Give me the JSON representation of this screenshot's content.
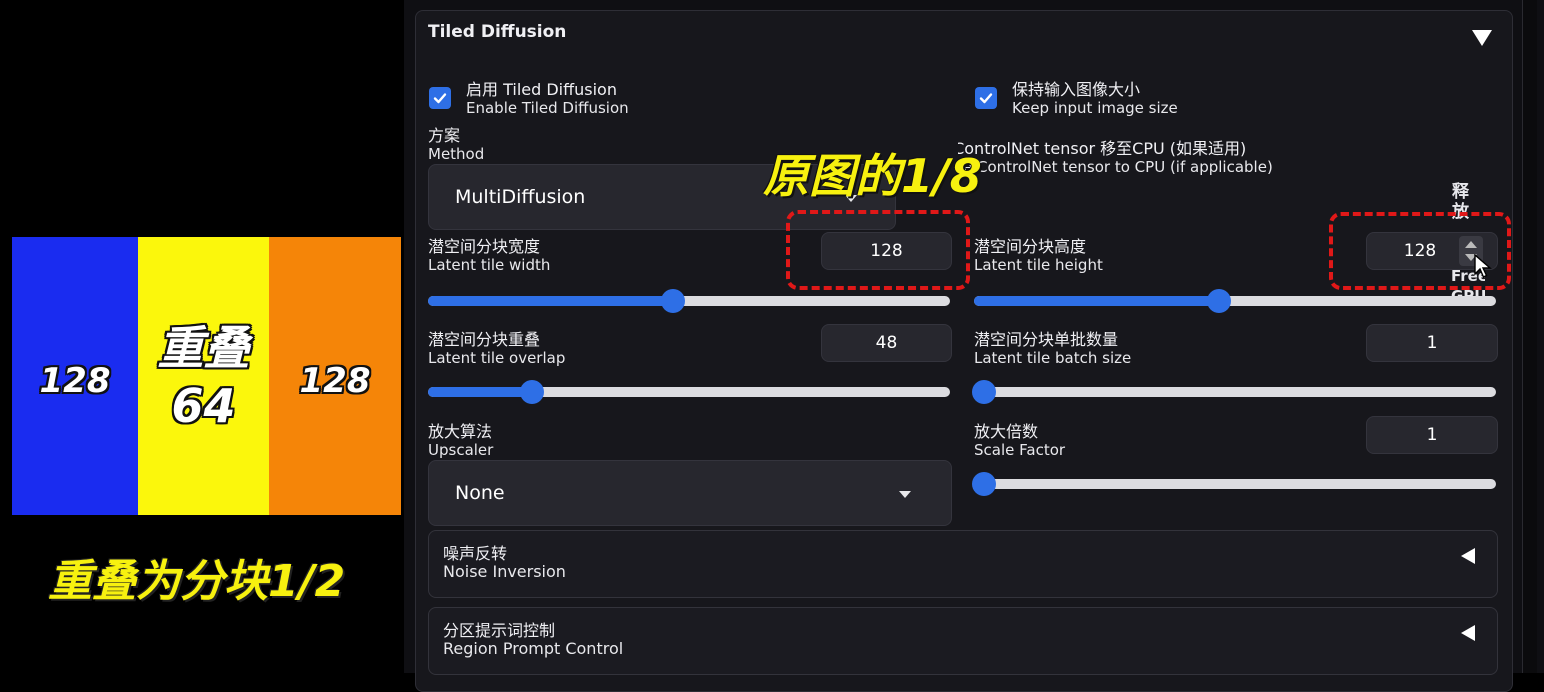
{
  "diagram": {
    "left_value": "128",
    "middle_title": "重叠",
    "middle_value": "64",
    "right_value": "128",
    "caption": "重叠为分块1/2",
    "colors": {
      "left": "#1a2cf0",
      "middle": "#fbf70c",
      "right": "#f58508"
    }
  },
  "panel": {
    "title": "Tiled Diffusion",
    "enable": {
      "zh": "启用 Tiled Diffusion",
      "en": "Enable Tiled Diffusion",
      "checked": true
    },
    "keep_size": {
      "zh": "保持输入图像大小",
      "en": "Keep input image size",
      "checked": true
    },
    "method": {
      "zh": "方案",
      "en": "Method",
      "value": "MultiDiffusion"
    },
    "controlnet_cpu": {
      "zh": "将 ControlNet tensor 移至CPU (如果适用)",
      "en": "Move ControlNet tensor to CPU (if applicable)"
    },
    "free_gpu": {
      "zh": "释放",
      "en": "Free GPU"
    },
    "tile_width": {
      "zh": "潜空间分块宽度",
      "en": "Latent tile width",
      "value": "128",
      "slider_fraction": 0.47
    },
    "tile_height": {
      "zh": "潜空间分块高度",
      "en": "Latent tile height",
      "value": "128",
      "slider_fraction": 0.47
    },
    "tile_overlap": {
      "zh": "潜空间分块重叠",
      "en": "Latent tile overlap",
      "value": "48",
      "slider_fraction": 0.2
    },
    "batch_size": {
      "zh": "潜空间分块单批数量",
      "en": "Latent tile batch size",
      "value": "1",
      "slider_fraction": 0.02
    },
    "upscaler": {
      "zh": "放大算法",
      "en": "Upscaler",
      "value": "None"
    },
    "scale_factor": {
      "zh": "放大倍数",
      "en": "Scale Factor",
      "value": "1",
      "slider_fraction": 0.02
    },
    "noise_inversion": {
      "zh": "噪声反转",
      "en": "Noise Inversion"
    },
    "region_prompt": {
      "zh": "分区提示词控制",
      "en": "Region Prompt Control"
    }
  },
  "annotation": {
    "text": "原图的1/8",
    "color": "#f7f10f",
    "box_color": "#e01818"
  },
  "accent_color": "#2e6fe6"
}
